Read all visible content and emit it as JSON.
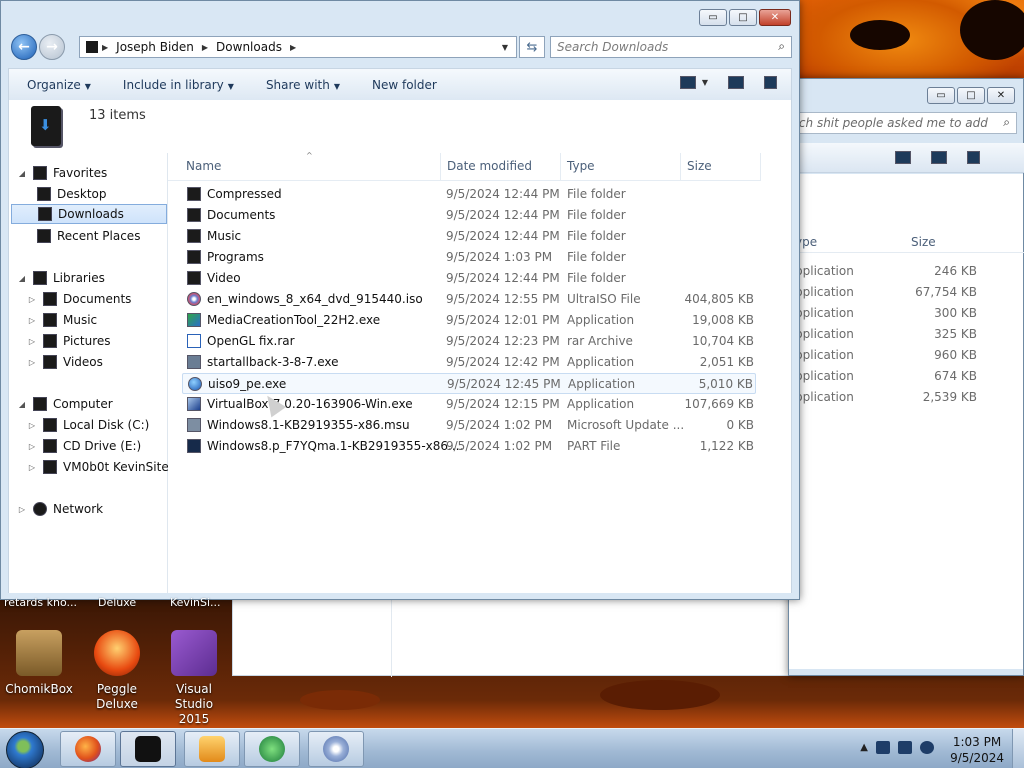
{
  "window": {
    "breadcrumb": [
      "Joseph Biden",
      "Downloads"
    ],
    "search_placeholder": "Search Downloads",
    "commands": [
      "Organize",
      "Include in library",
      "Share with",
      "New folder"
    ],
    "item_count": "13 items"
  },
  "nav": {
    "favorites": "Favorites",
    "desktop": "Desktop",
    "downloads": "Downloads",
    "recent": "Recent Places",
    "libraries": "Libraries",
    "documents": "Documents",
    "music": "Music",
    "pictures": "Pictures",
    "videos": "Videos",
    "computer": "Computer",
    "local_disk": "Local Disk (C:)",
    "cd_drive": "CD Drive (E:)",
    "vm": "VM0b0t KevinSite",
    "network": "Network"
  },
  "columns": {
    "name": "Name",
    "date": "Date modified",
    "type": "Type",
    "size": "Size"
  },
  "files": [
    {
      "name": "Compressed",
      "date": "9/5/2024 12:44 PM",
      "type": "File folder",
      "size": ""
    },
    {
      "name": "Documents",
      "date": "9/5/2024 12:44 PM",
      "type": "File folder",
      "size": ""
    },
    {
      "name": "Music",
      "date": "9/5/2024 12:44 PM",
      "type": "File folder",
      "size": ""
    },
    {
      "name": "Programs",
      "date": "9/5/2024 1:03 PM",
      "type": "File folder",
      "size": ""
    },
    {
      "name": "Video",
      "date": "9/5/2024 12:44 PM",
      "type": "File folder",
      "size": ""
    },
    {
      "name": "en_windows_8_x64_dvd_915440.iso",
      "date": "9/5/2024 12:55 PM",
      "type": "UltraISO File",
      "size": "404,805 KB"
    },
    {
      "name": "MediaCreationTool_22H2.exe",
      "date": "9/5/2024 12:01 PM",
      "type": "Application",
      "size": "19,008 KB"
    },
    {
      "name": "OpenGL fix.rar",
      "date": "9/5/2024 12:23 PM",
      "type": "rar Archive",
      "size": "10,704 KB"
    },
    {
      "name": "startallback-3-8-7.exe",
      "date": "9/5/2024 12:42 PM",
      "type": "Application",
      "size": "2,051 KB"
    },
    {
      "name": "uiso9_pe.exe",
      "date": "9/5/2024 12:45 PM",
      "type": "Application",
      "size": "5,010 KB"
    },
    {
      "name": "VirtualBox-7.0.20-163906-Win.exe",
      "date": "9/5/2024 12:15 PM",
      "type": "Application",
      "size": "107,669 KB"
    },
    {
      "name": "Windows8.1-KB2919355-x86.msu",
      "date": "9/5/2024 1:02 PM",
      "type": "Microsoft Update ...",
      "size": "0 KB"
    },
    {
      "name": "Windows8.p_F7YQma.1-KB2919355-x86....",
      "date": "9/5/2024 1:02 PM",
      "type": "PART File",
      "size": "1,122 KB"
    }
  ],
  "back_window": {
    "search_text": "rch shit people asked me to add",
    "type_col": "ype",
    "size_col": "Size",
    "rows": [
      {
        "type": "pplication",
        "size": "246 KB"
      },
      {
        "type": "pplication",
        "size": "67,754 KB"
      },
      {
        "type": "pplication",
        "size": "300 KB"
      },
      {
        "type": "pplication",
        "size": "325 KB"
      },
      {
        "type": "pplication",
        "size": "960 KB"
      },
      {
        "type": "pplication",
        "size": "674 KB"
      },
      {
        "type": "pplication",
        "size": "2,539 KB"
      }
    ]
  },
  "desktop_icons": {
    "cut1": "retards kno...",
    "cut2": "Deluxe",
    "cut3": "KevinSi...",
    "chomik": "ChomikBox",
    "peggle": "Peggle Deluxe",
    "vs_line1": "Visual Studio",
    "vs_line2": "2015"
  },
  "clock": {
    "time": "1:03 PM",
    "date": "9/5/2024"
  },
  "icons": {
    "back": "back-arrow-icon",
    "forward": "forward-arrow-icon",
    "refresh": "refresh-icon",
    "search": "search-icon"
  }
}
